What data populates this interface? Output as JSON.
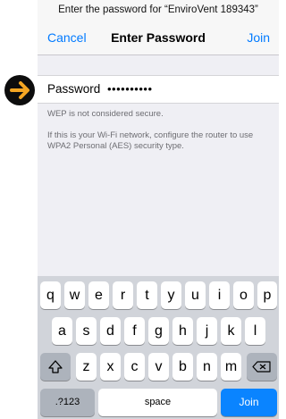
{
  "prompt_text": "Enter the password for “EnviroVent 189343”",
  "nav": {
    "cancel": "Cancel",
    "title": "Enter Password",
    "join": "Join"
  },
  "field": {
    "label": "Password",
    "value": "••••••••••"
  },
  "notes": {
    "wep": "WEP is not considered secure.",
    "advice": "If this is your Wi-Fi network, configure the router to use WPA2 Personal (AES) security type."
  },
  "keyboard": {
    "row1": [
      "q",
      "w",
      "e",
      "r",
      "t",
      "y",
      "u",
      "i",
      "o",
      "p"
    ],
    "row2": [
      "a",
      "s",
      "d",
      "f",
      "g",
      "h",
      "j",
      "k",
      "l"
    ],
    "row3": [
      "z",
      "x",
      "c",
      "v",
      "b",
      "n",
      "m"
    ],
    "numbers": ".?123",
    "space": "space",
    "join": "Join"
  },
  "colors": {
    "accent": "#007aff",
    "join_key": "#0a84ff",
    "arrow": "#f5a623"
  },
  "icons": {
    "pointer": "arrow-right-icon",
    "shift": "shift-icon",
    "delete": "backspace-icon"
  }
}
